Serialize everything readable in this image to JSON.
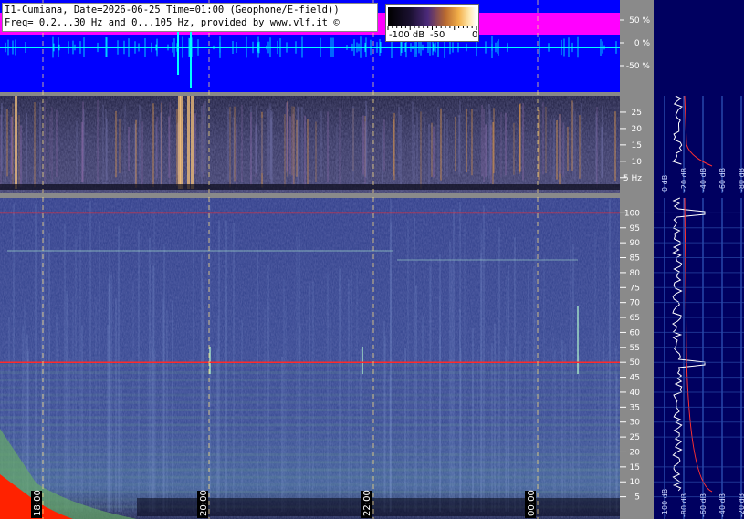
{
  "header": {
    "line1": "I1-Cumiana, Date=2026-06-25 Time=01:00 (Geophone/E-field))",
    "line2": "Freq= 0.2...30 Hz and 0...105 Hz, provided by www.vlf.it ©"
  },
  "legend": {
    "labels": [
      "-100 dB",
      "-50",
      "0"
    ]
  },
  "chart_data": [
    {
      "type": "area",
      "panel": "amplitude",
      "y_tick_labels": [
        "50 %",
        "0 %",
        "-50 %"
      ],
      "ylim": [
        -100,
        100
      ],
      "colors": {
        "background": "#0000ff",
        "envelope": "#ff00ff",
        "signal": "#00ffff"
      }
    },
    {
      "type": "heatmap",
      "panel": "spectrogram-low",
      "y_tick_labels": [
        "25",
        "20",
        "15",
        "10",
        "5 Hz"
      ],
      "ylim": [
        0.2,
        30
      ],
      "side_spectrum_tick_labels": [
        "0 dB",
        "-20 dB",
        "-40 dB",
        "-60 dB",
        "-80 dB"
      ]
    },
    {
      "type": "heatmap",
      "panel": "spectrogram-high",
      "y_tick_labels": [
        "100",
        "95",
        "90",
        "85",
        "80",
        "75",
        "70",
        "65",
        "60",
        "55",
        "50",
        "45",
        "40",
        "35",
        "30",
        "25",
        "20",
        "15",
        "10",
        "5"
      ],
      "ylim": [
        0,
        105
      ],
      "x_tick_labels": [
        "18:00",
        "20:00",
        "22:00",
        "00:00"
      ],
      "side_spectrum_tick_labels": [
        "-100 dB",
        "-80 dB",
        "-60 dB",
        "-40 dB",
        "-20 dB"
      ],
      "lines_hz": [
        100,
        50
      ]
    }
  ]
}
